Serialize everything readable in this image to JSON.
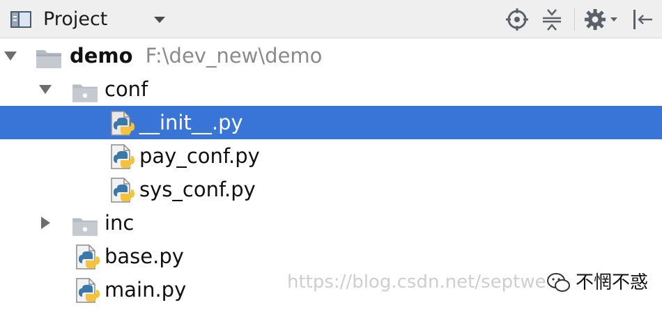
{
  "toolbar": {
    "title": "Project",
    "icons": [
      "project-view-icon",
      "dropdown-arrow-icon",
      "locate-icon",
      "collapse-all-icon",
      "gear-icon",
      "hide-panel-icon"
    ]
  },
  "tree": {
    "root": {
      "name": "demo",
      "path": "F:\\dev_new\\demo"
    },
    "folders": {
      "conf": "conf",
      "inc": "inc"
    },
    "files": {
      "init": "__init__.py",
      "pay_conf": "pay_conf.py",
      "sys_conf": "sys_conf.py",
      "base": "base.py",
      "main": "main.py"
    }
  },
  "watermark": {
    "url": "https://blog.csdn.net/septwe",
    "badge": "不惘不惑"
  },
  "colors": {
    "selection": "#3875d7",
    "toolbar_bg": "#efefef",
    "python_blue": "#3b78aa",
    "python_yellow": "#f5c33b"
  }
}
